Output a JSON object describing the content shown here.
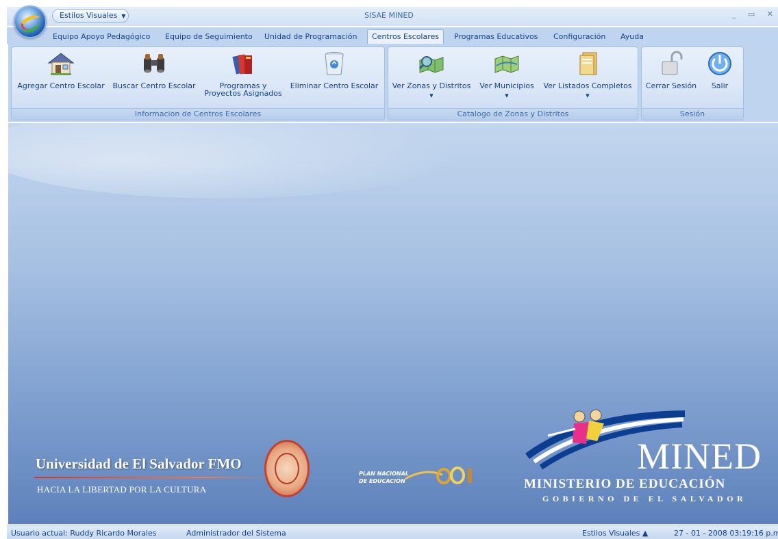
{
  "window": {
    "title": "SISAE MINED",
    "quick_access_label": "Estilos Visuales",
    "controls": "_ ▭ ✕"
  },
  "tabs": [
    {
      "label": "Equipo Apoyo Pedagógico",
      "active": false
    },
    {
      "label": "Equipo de Seguimiento",
      "active": false
    },
    {
      "label": "Unidad de Programación",
      "active": false
    },
    {
      "label": "Centros Escolares",
      "active": true
    },
    {
      "label": "Programas  Educativos",
      "active": false
    },
    {
      "label": "Configuración",
      "active": false
    },
    {
      "label": "Ayuda",
      "active": false
    }
  ],
  "ribbon": {
    "groups": [
      {
        "label": "Informacion de Centros Escolares",
        "buttons": [
          {
            "label": "Agregar Centro Escolar",
            "icon": "house-icon"
          },
          {
            "label": "Buscar Centro Escolar",
            "icon": "binoculars-icon"
          },
          {
            "label": "Programas y",
            "label2": "Proyectos Asignados",
            "icon": "books-icon"
          },
          {
            "label": "Eliminar Centro Escolar",
            "icon": "recycle-bin-icon"
          }
        ]
      },
      {
        "label": "Catalogo de Zonas y Distritos",
        "buttons": [
          {
            "label": "Ver Zonas y Distritos",
            "icon": "map-search-icon",
            "dropdown": "▼"
          },
          {
            "label": "Ver Municipios",
            "icon": "map-icon",
            "dropdown": "▼"
          },
          {
            "label": "Ver Listados Completos",
            "icon": "folder-icon",
            "dropdown": "▼"
          }
        ]
      },
      {
        "label": "Sesión",
        "buttons": [
          {
            "label": "Cerrar Sesión",
            "icon": "padlock-open-icon"
          },
          {
            "label": "Salir",
            "icon": "power-icon"
          }
        ]
      }
    ]
  },
  "main": {
    "university_name": "Universidad de El Salvador  FMO",
    "university_motto": "HACIA LA LIBERTAD POR LA CULTURA",
    "plan_line1": "PLAN NACIONAL",
    "plan_line2": "DE EDUCACIÓN",
    "plan_year": "2021",
    "mined_title": "MINED",
    "mined_subtitle": "MINISTERIO DE EDUCACIÓN",
    "mined_government": "GOBIERNO DE EL SALVADOR"
  },
  "statusbar": {
    "user": "Usuario actual:  Ruddy Ricardo Morales",
    "role": "Administrador del Sistema",
    "style": "Estilos Visuales  ▲",
    "datetime": "27 - 01 - 2008  03:19:16 p.m."
  },
  "colors": {
    "ribbon_text": "#15428b",
    "ribbon_bg": "#bfd4ee",
    "main_bg_top": "#c3d6ee",
    "main_bg_bottom": "#5d81bb"
  }
}
